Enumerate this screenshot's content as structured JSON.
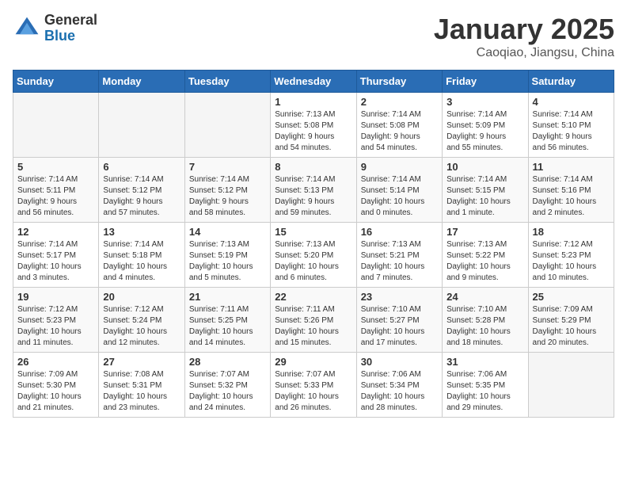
{
  "logo": {
    "general": "General",
    "blue": "Blue"
  },
  "header": {
    "title": "January 2025",
    "subtitle": "Caoqiao, Jiangsu, China"
  },
  "weekdays": [
    "Sunday",
    "Monday",
    "Tuesday",
    "Wednesday",
    "Thursday",
    "Friday",
    "Saturday"
  ],
  "weeks": [
    [
      {
        "day": "",
        "info": ""
      },
      {
        "day": "",
        "info": ""
      },
      {
        "day": "",
        "info": ""
      },
      {
        "day": "1",
        "info": "Sunrise: 7:13 AM\nSunset: 5:08 PM\nDaylight: 9 hours\nand 54 minutes."
      },
      {
        "day": "2",
        "info": "Sunrise: 7:14 AM\nSunset: 5:08 PM\nDaylight: 9 hours\nand 54 minutes."
      },
      {
        "day": "3",
        "info": "Sunrise: 7:14 AM\nSunset: 5:09 PM\nDaylight: 9 hours\nand 55 minutes."
      },
      {
        "day": "4",
        "info": "Sunrise: 7:14 AM\nSunset: 5:10 PM\nDaylight: 9 hours\nand 56 minutes."
      }
    ],
    [
      {
        "day": "5",
        "info": "Sunrise: 7:14 AM\nSunset: 5:11 PM\nDaylight: 9 hours\nand 56 minutes."
      },
      {
        "day": "6",
        "info": "Sunrise: 7:14 AM\nSunset: 5:12 PM\nDaylight: 9 hours\nand 57 minutes."
      },
      {
        "day": "7",
        "info": "Sunrise: 7:14 AM\nSunset: 5:12 PM\nDaylight: 9 hours\nand 58 minutes."
      },
      {
        "day": "8",
        "info": "Sunrise: 7:14 AM\nSunset: 5:13 PM\nDaylight: 9 hours\nand 59 minutes."
      },
      {
        "day": "9",
        "info": "Sunrise: 7:14 AM\nSunset: 5:14 PM\nDaylight: 10 hours\nand 0 minutes."
      },
      {
        "day": "10",
        "info": "Sunrise: 7:14 AM\nSunset: 5:15 PM\nDaylight: 10 hours\nand 1 minute."
      },
      {
        "day": "11",
        "info": "Sunrise: 7:14 AM\nSunset: 5:16 PM\nDaylight: 10 hours\nand 2 minutes."
      }
    ],
    [
      {
        "day": "12",
        "info": "Sunrise: 7:14 AM\nSunset: 5:17 PM\nDaylight: 10 hours\nand 3 minutes."
      },
      {
        "day": "13",
        "info": "Sunrise: 7:14 AM\nSunset: 5:18 PM\nDaylight: 10 hours\nand 4 minutes."
      },
      {
        "day": "14",
        "info": "Sunrise: 7:13 AM\nSunset: 5:19 PM\nDaylight: 10 hours\nand 5 minutes."
      },
      {
        "day": "15",
        "info": "Sunrise: 7:13 AM\nSunset: 5:20 PM\nDaylight: 10 hours\nand 6 minutes."
      },
      {
        "day": "16",
        "info": "Sunrise: 7:13 AM\nSunset: 5:21 PM\nDaylight: 10 hours\nand 7 minutes."
      },
      {
        "day": "17",
        "info": "Sunrise: 7:13 AM\nSunset: 5:22 PM\nDaylight: 10 hours\nand 9 minutes."
      },
      {
        "day": "18",
        "info": "Sunrise: 7:12 AM\nSunset: 5:23 PM\nDaylight: 10 hours\nand 10 minutes."
      }
    ],
    [
      {
        "day": "19",
        "info": "Sunrise: 7:12 AM\nSunset: 5:23 PM\nDaylight: 10 hours\nand 11 minutes."
      },
      {
        "day": "20",
        "info": "Sunrise: 7:12 AM\nSunset: 5:24 PM\nDaylight: 10 hours\nand 12 minutes."
      },
      {
        "day": "21",
        "info": "Sunrise: 7:11 AM\nSunset: 5:25 PM\nDaylight: 10 hours\nand 14 minutes."
      },
      {
        "day": "22",
        "info": "Sunrise: 7:11 AM\nSunset: 5:26 PM\nDaylight: 10 hours\nand 15 minutes."
      },
      {
        "day": "23",
        "info": "Sunrise: 7:10 AM\nSunset: 5:27 PM\nDaylight: 10 hours\nand 17 minutes."
      },
      {
        "day": "24",
        "info": "Sunrise: 7:10 AM\nSunset: 5:28 PM\nDaylight: 10 hours\nand 18 minutes."
      },
      {
        "day": "25",
        "info": "Sunrise: 7:09 AM\nSunset: 5:29 PM\nDaylight: 10 hours\nand 20 minutes."
      }
    ],
    [
      {
        "day": "26",
        "info": "Sunrise: 7:09 AM\nSunset: 5:30 PM\nDaylight: 10 hours\nand 21 minutes."
      },
      {
        "day": "27",
        "info": "Sunrise: 7:08 AM\nSunset: 5:31 PM\nDaylight: 10 hours\nand 23 minutes."
      },
      {
        "day": "28",
        "info": "Sunrise: 7:07 AM\nSunset: 5:32 PM\nDaylight: 10 hours\nand 24 minutes."
      },
      {
        "day": "29",
        "info": "Sunrise: 7:07 AM\nSunset: 5:33 PM\nDaylight: 10 hours\nand 26 minutes."
      },
      {
        "day": "30",
        "info": "Sunrise: 7:06 AM\nSunset: 5:34 PM\nDaylight: 10 hours\nand 28 minutes."
      },
      {
        "day": "31",
        "info": "Sunrise: 7:06 AM\nSunset: 5:35 PM\nDaylight: 10 hours\nand 29 minutes."
      },
      {
        "day": "",
        "info": ""
      }
    ]
  ]
}
